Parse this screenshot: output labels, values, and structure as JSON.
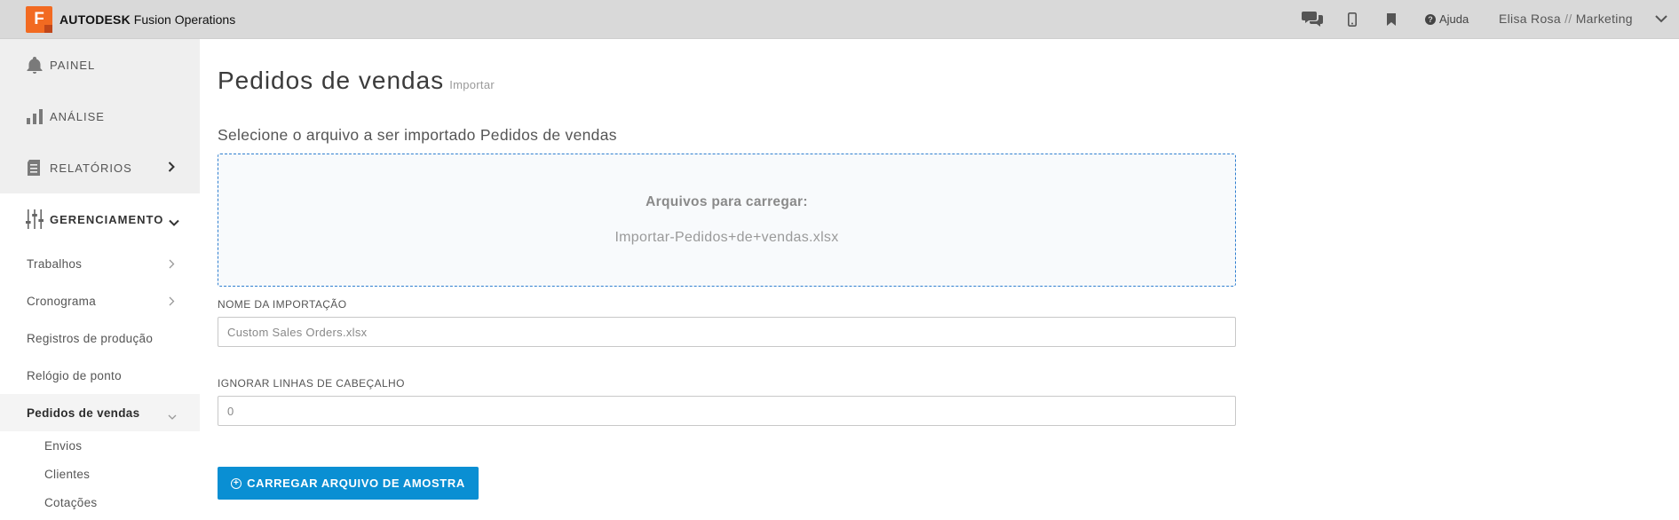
{
  "app": {
    "brand_bold": "AUTODESK",
    "brand_product": "Fusion Operations",
    "logo_letter": "F"
  },
  "topbar": {
    "help_label": "Ajuda",
    "user_name": "Elisa Rosa",
    "user_separator": "//",
    "user_team": "Marketing",
    "icons": [
      "chat-icon",
      "mobile-icon",
      "bookmark-icon",
      "help-icon",
      "chevron-down-icon"
    ]
  },
  "sidebar": {
    "main_items": [
      {
        "label": "PAINEL",
        "icon": "bell-icon"
      },
      {
        "label": "ANÁLISE",
        "icon": "bar-chart-icon"
      },
      {
        "label": "RELATÓRIOS",
        "icon": "report-icon"
      },
      {
        "label": "GERENCIAMENTO",
        "icon": "sliders-icon"
      }
    ],
    "sub_items": [
      {
        "label": "Trabalhos"
      },
      {
        "label": "Cronograma"
      },
      {
        "label": "Registros de produção"
      },
      {
        "label": "Relógio de ponto"
      },
      {
        "label": "Pedidos de vendas"
      }
    ],
    "sub_sub_items": [
      {
        "label": "Envios"
      },
      {
        "label": "Clientes"
      },
      {
        "label": "Cotações"
      }
    ]
  },
  "main": {
    "title": "Pedidos de vendas",
    "subtitle": "Importar",
    "select_label": "Selecione o arquivo a ser importado Pedidos de vendas",
    "dropzone": {
      "title": "Arquivos para carregar:",
      "file_name": "Importar-Pedidos+de+vendas.xlsx"
    },
    "import_name": {
      "label": "NOME DA IMPORTAÇÃO",
      "value": "Custom Sales Orders.xlsx"
    },
    "ignore_header": {
      "label": "IGNORAR LINHAS DE CABEÇALHO",
      "value": "0"
    },
    "upload_button": "CARREGAR ARQUIVO DE AMOSTRA"
  },
  "colors": {
    "accent": "#0a8fd3",
    "logo": "#f26a21",
    "topbar": "#d9d9d9",
    "dropzone_border": "#2f7fd0"
  }
}
